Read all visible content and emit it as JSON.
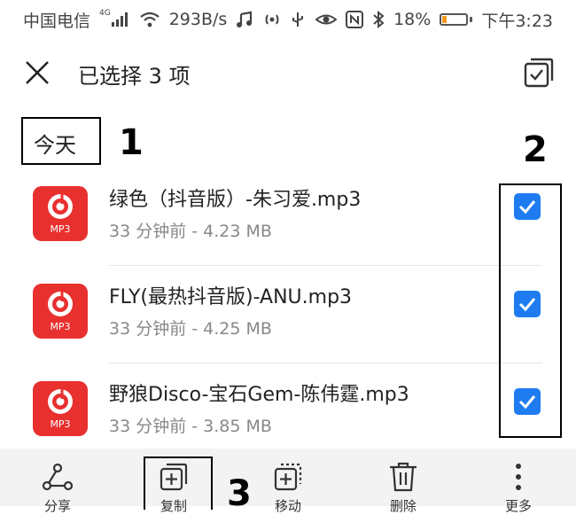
{
  "status_bar": {
    "carrier": "中国电信",
    "network_badge": "4G",
    "speed": "293B/s",
    "battery_percent": "18%",
    "battery_level": 0.18,
    "time": "下午3:23",
    "icons": [
      "signal-icon",
      "wifi-icon",
      "music-icon",
      "hotspot-icon",
      "usb-icon",
      "eye-icon",
      "nfc-icon",
      "bluetooth-icon",
      "battery-icon"
    ]
  },
  "header": {
    "title": "已选择 3 项",
    "close_icon": "close-icon",
    "select_all_icon": "select-all-icon"
  },
  "section": {
    "label": "今天"
  },
  "annotations": {
    "one": "1",
    "two": "2",
    "three": "3"
  },
  "files": [
    {
      "name": "绿色（抖音版）-朱习爱.mp3",
      "meta": "33 分钟前 - 4.23 MB",
      "icon_label": "MP3",
      "checked": true
    },
    {
      "name": "FLY(最热抖音版)-ANU.mp3",
      "meta": "33 分钟前 - 4.25 MB",
      "icon_label": "MP3",
      "checked": true
    },
    {
      "name": "野狼Disco-宝石Gem-陈伟霆.mp3",
      "meta": "33 分钟前 - 3.85 MB",
      "icon_label": "MP3",
      "checked": true
    }
  ],
  "bottom_actions": [
    {
      "label": "分享",
      "icon": "share-icon"
    },
    {
      "label": "复制",
      "icon": "copy-icon"
    },
    {
      "label": "移动",
      "icon": "move-icon"
    },
    {
      "label": "删除",
      "icon": "delete-icon"
    },
    {
      "label": "更多",
      "icon": "more-icon"
    }
  ],
  "colors": {
    "accent": "#1e7cf0",
    "file_icon": "#e8302f",
    "battery": "#f39a1e",
    "bottom_bar": "#f3f3f3"
  }
}
